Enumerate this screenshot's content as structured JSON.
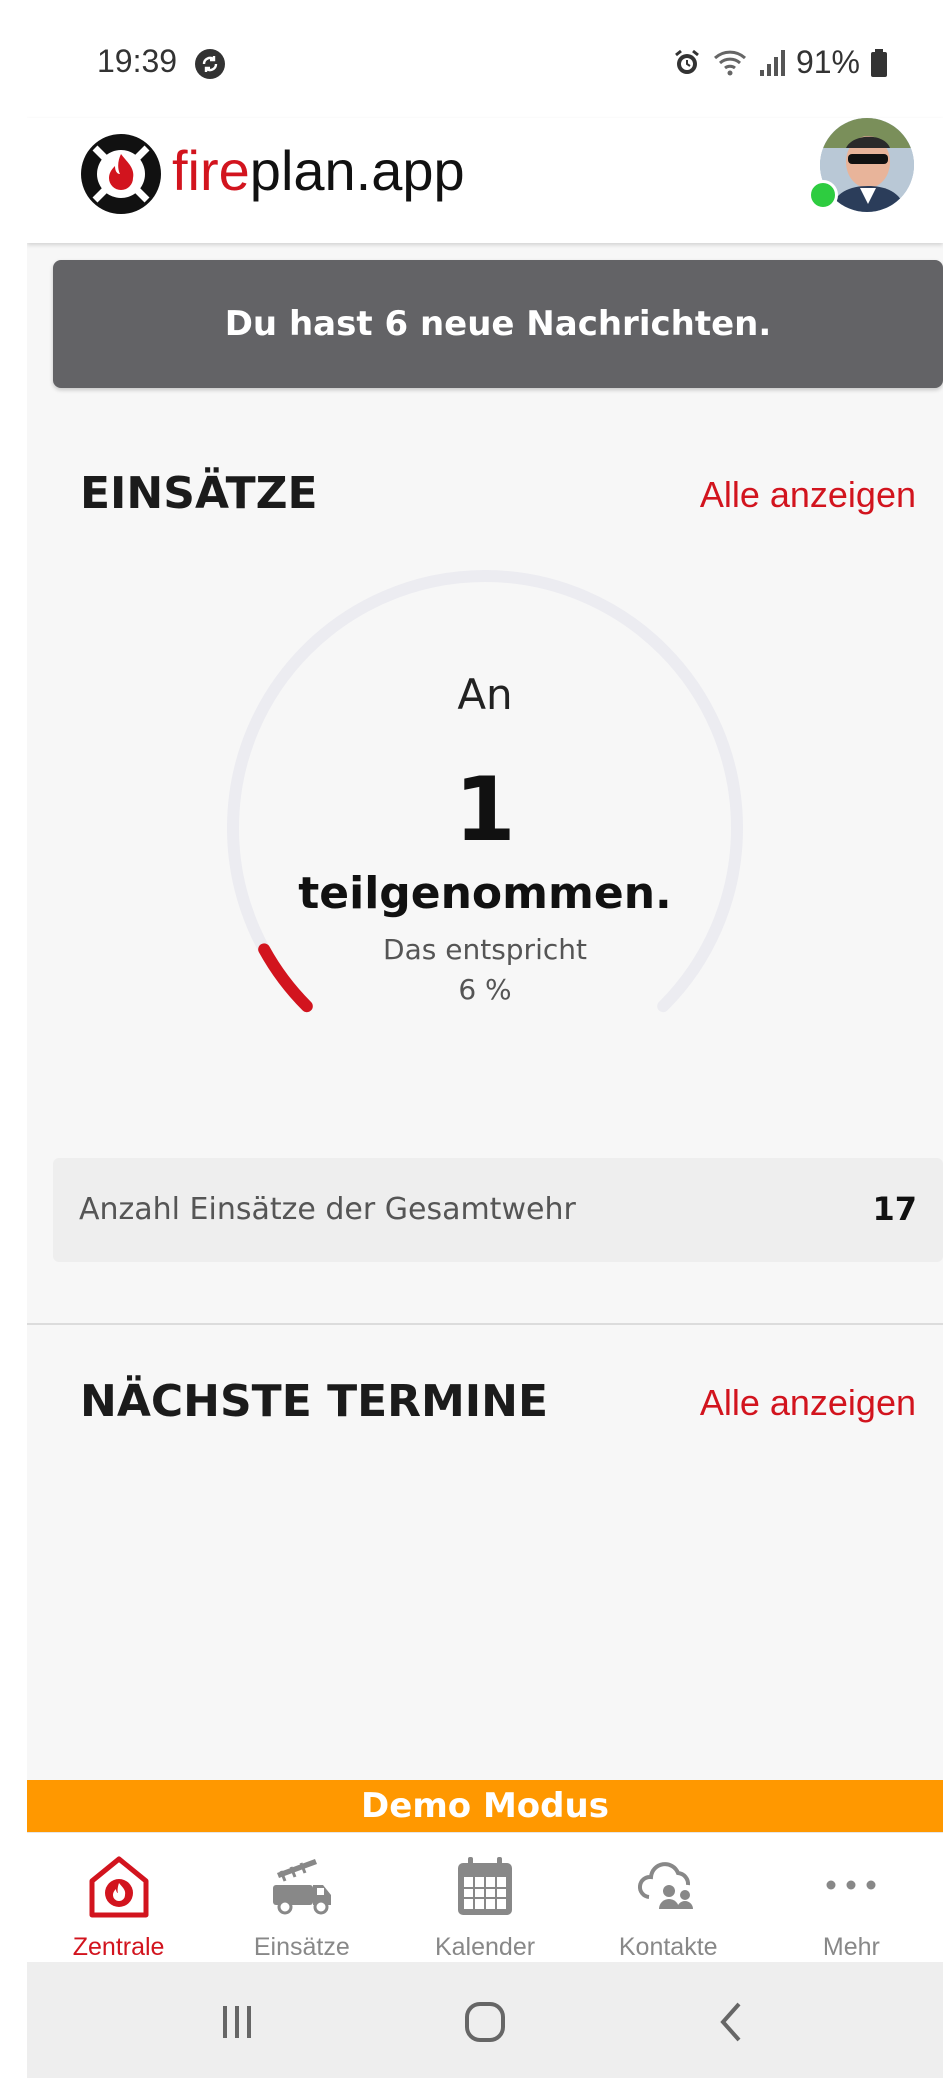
{
  "status_bar": {
    "time": "19:39",
    "battery": "91%"
  },
  "header": {
    "brand_fire": "fire",
    "brand_rest": "plan.app"
  },
  "banner": {
    "text": "Du hast 6 neue Nachrichten."
  },
  "einsaetze": {
    "title": "EINSÄTZE",
    "link": "Alle anzeigen",
    "gauge": {
      "prefix": "An",
      "count": "1",
      "label": "teilgenommen.",
      "sub": "Das entspricht",
      "percent_text": "6 %",
      "percent": 6
    },
    "total_label": "Anzahl Einsätze der Gesamtwehr",
    "total_value": "17"
  },
  "termine": {
    "title": "NÄCHSTE TERMINE",
    "link": "Alle anzeigen"
  },
  "demo_banner": "Demo Modus",
  "tabs": [
    {
      "label": "Zentrale",
      "icon": "home-fire-icon",
      "active": true
    },
    {
      "label": "Einsätze",
      "icon": "fire-truck-icon",
      "active": false
    },
    {
      "label": "Kalender",
      "icon": "calendar-icon",
      "active": false
    },
    {
      "label": "Kontakte",
      "icon": "contacts-cloud-icon",
      "active": false
    },
    {
      "label": "Mehr",
      "icon": "more-dots-icon",
      "active": false
    }
  ],
  "colors": {
    "accent": "#d2141e",
    "demo": "#ff9800",
    "banner": "#636366"
  }
}
